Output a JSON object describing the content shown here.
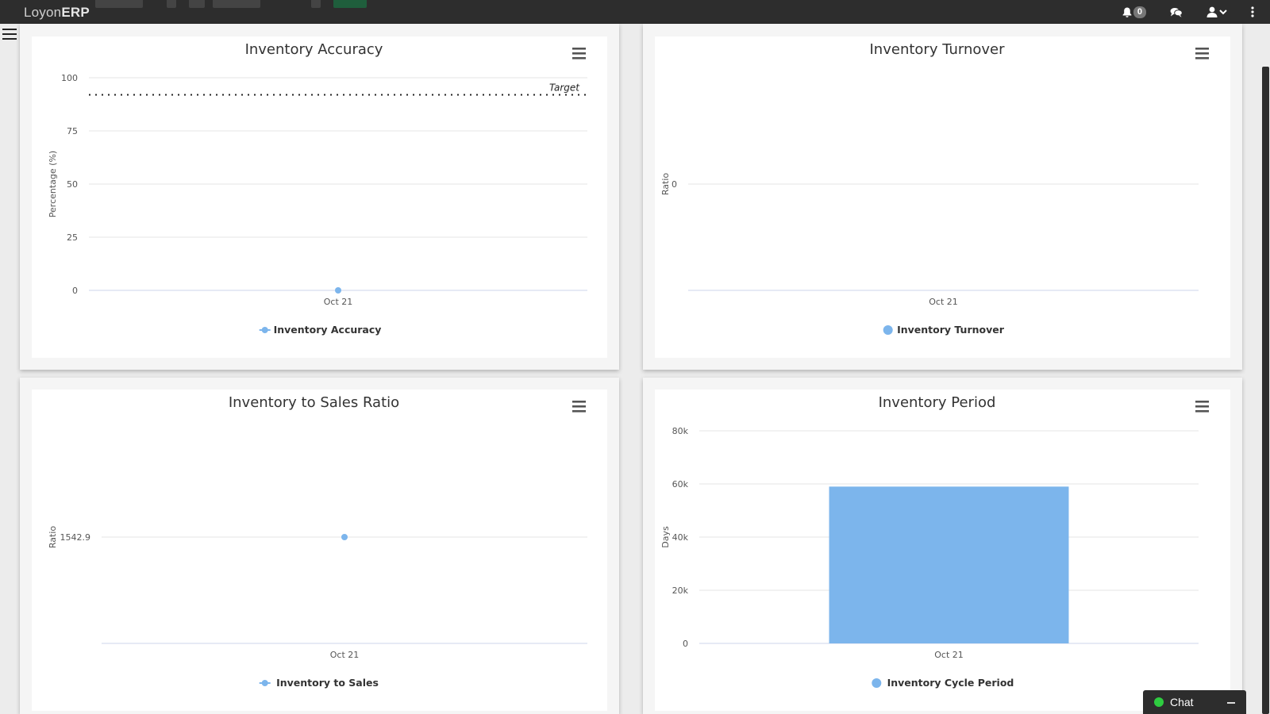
{
  "app": {
    "brand_light": "Loyon",
    "brand_bold": "ERP"
  },
  "header": {
    "notification_count": "0",
    "icons": [
      "bell-icon",
      "chat-bubbles-icon",
      "user-icon",
      "kebab-menu-icon"
    ]
  },
  "colors": {
    "series": "#7cb5ec",
    "topbar": "#2d2d2d",
    "chat_online": "#2ecc40"
  },
  "chat": {
    "label": "Chat"
  },
  "chart_data": [
    {
      "id": "accuracy",
      "type": "line",
      "title": "Inventory Accuracy",
      "ylabel": "Percentage (%)",
      "categories": [
        "Oct 21"
      ],
      "series": [
        {
          "name": "Inventory Accuracy",
          "values": [
            0
          ]
        }
      ],
      "ylim": [
        0,
        100
      ],
      "yticks": [
        0,
        25,
        50,
        75,
        100
      ],
      "plot_line": {
        "label": "Target",
        "value": 92
      },
      "legend": "bottom-center",
      "grid": true
    },
    {
      "id": "turnover",
      "type": "scatter",
      "title": "Inventory Turnover",
      "ylabel": "Ratio",
      "categories": [
        "Oct 21"
      ],
      "series": [
        {
          "name": "Inventory Turnover",
          "values": []
        }
      ],
      "yticks": [
        0
      ],
      "legend": "bottom-center",
      "grid": true
    },
    {
      "id": "sales",
      "type": "line",
      "title": "Inventory to Sales Ratio",
      "ylabel": "Ratio",
      "categories": [
        "Oct 21"
      ],
      "series": [
        {
          "name": "Inventory to Sales",
          "values": [
            1542.9
          ]
        }
      ],
      "yticks": [
        1542.9
      ],
      "legend": "bottom-center",
      "grid": true
    },
    {
      "id": "period",
      "type": "bar",
      "title": "Inventory Period",
      "ylabel": "Days",
      "categories": [
        "Oct 21"
      ],
      "series": [
        {
          "name": "Inventory Cycle Period",
          "values": [
            59000
          ]
        }
      ],
      "ylim": [
        0,
        80000
      ],
      "yticks": [
        "0",
        "20k",
        "40k",
        "60k",
        "80k"
      ],
      "legend": "bottom-center",
      "grid": true
    }
  ]
}
